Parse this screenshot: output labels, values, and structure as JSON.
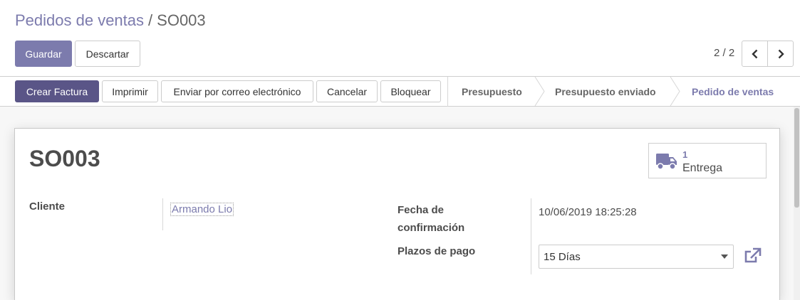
{
  "breadcrumb": {
    "parent": "Pedidos de ventas",
    "separator": "/",
    "current": "SO003"
  },
  "actions": {
    "save_label": "Guardar",
    "discard_label": "Descartar"
  },
  "pager": {
    "value": "2 / 2",
    "prev_icon": "chevron-left-icon",
    "next_icon": "chevron-right-icon"
  },
  "statusbar": {
    "buttons": [
      {
        "label": "Crear Factura",
        "primary": true
      },
      {
        "label": "Imprimir"
      },
      {
        "label": "Enviar por correo electrónico"
      },
      {
        "label": "Cancelar"
      },
      {
        "label": "Bloquear"
      }
    ],
    "stages": [
      {
        "label": "Presupuesto",
        "active": false
      },
      {
        "label": "Presupuesto enviado",
        "active": false
      },
      {
        "label": "Pedido de ventas",
        "active": true
      }
    ]
  },
  "form": {
    "title": "SO003",
    "smart_button": {
      "count": "1",
      "label": "Entrega",
      "icon": "truck-icon"
    },
    "customer": {
      "label": "Cliente",
      "value": "Armando Lio"
    },
    "confirmation_date": {
      "label_line1": "Fecha de",
      "label_line2": "confirmación",
      "value": "10/06/2019 18:25:28"
    },
    "payment_terms": {
      "label": "Plazos de pago",
      "value": "15 Días",
      "external_link_icon": "external-link-icon"
    }
  },
  "colors": {
    "primary": "#7c7bad",
    "primary_dark": "#5a5587"
  }
}
